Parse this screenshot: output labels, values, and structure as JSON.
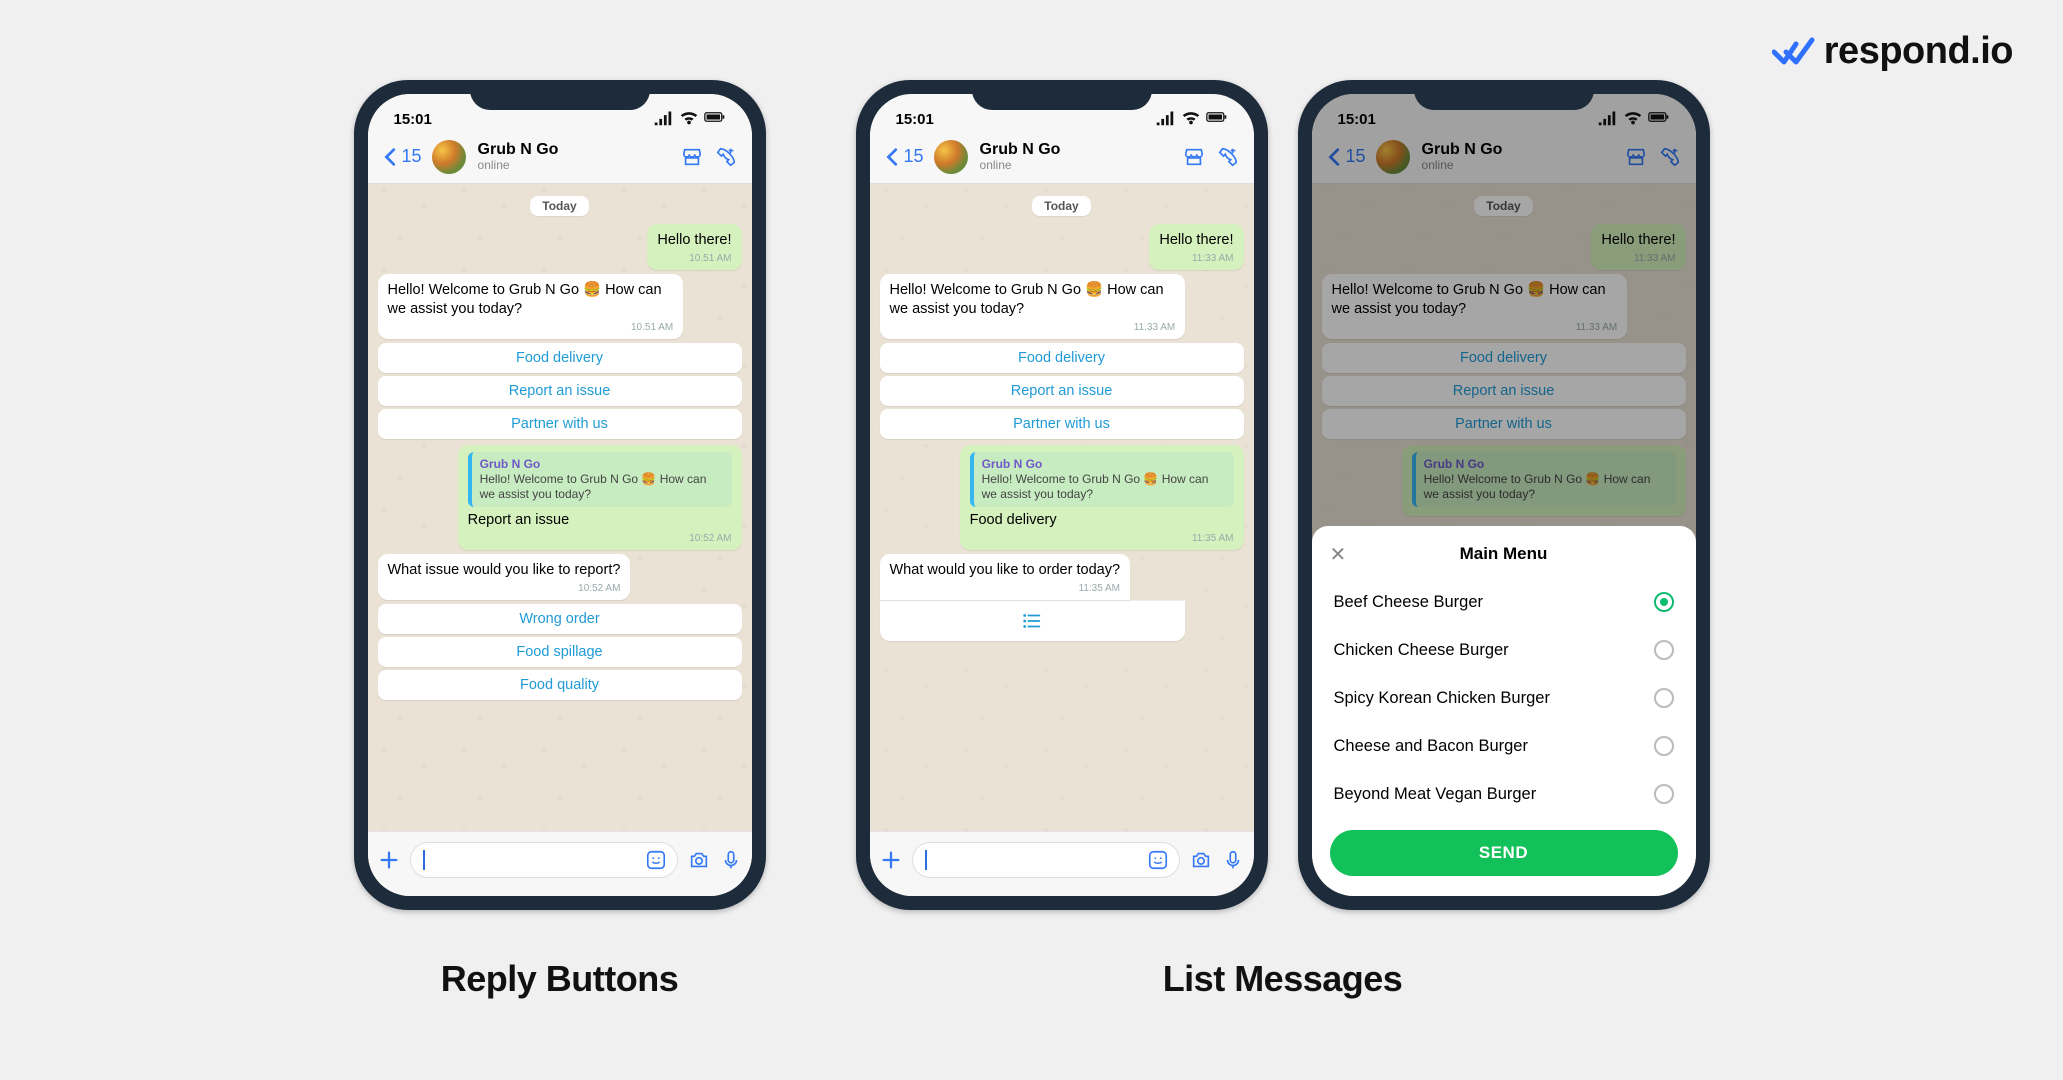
{
  "brand": {
    "name": "respond.io"
  },
  "captions": {
    "reply": "Reply Buttons",
    "list": "List Messages"
  },
  "status": {
    "time": "15:01",
    "signal": "●●●●",
    "wifi": true,
    "battery": true
  },
  "header": {
    "back_count": "15",
    "contact_name": "Grub N Go",
    "contact_status": "online"
  },
  "chip": {
    "today": "Today"
  },
  "common": {
    "hello_out": "Hello there!",
    "welcome_in": "Hello! Welcome to Grub N Go 🍔 How can we assist you today?",
    "options": {
      "food": "Food delivery",
      "issue": "Report an issue",
      "partner": "Partner with us"
    },
    "quote_from": "Grub N Go",
    "quote_text": "Hello! Welcome to Grub N Go 🍔 How can we assist you today?"
  },
  "phone1": {
    "t_hello": "10.51 AM",
    "t_welcome": "10.51 AM",
    "reply_choice": "Report an issue",
    "t_reply": "10:52 AM",
    "followup": "What issue would you like to report?",
    "t_follow": "10:52 AM",
    "opts": {
      "a": "Wrong order",
      "b": "Food spillage",
      "c": "Food quality"
    }
  },
  "phone2": {
    "t_hello": "11:33 AM",
    "t_welcome": "11.33 AM",
    "reply_choice": "Food delivery",
    "t_reply": "11:35 AM",
    "followup": "What would you like to order today?",
    "t_follow": "11:35 AM"
  },
  "phone3": {
    "t_hello": "11:33 AM",
    "t_welcome": "11.33 AM"
  },
  "sheet": {
    "title": "Main Menu",
    "options": [
      "Beef Cheese Burger",
      "Chicken Cheese Burger",
      "Spicy Korean Chicken Burger",
      "Cheese and Bacon Burger",
      "Beyond Meat Vegan Burger"
    ],
    "selected_index": 0,
    "send": "SEND"
  }
}
